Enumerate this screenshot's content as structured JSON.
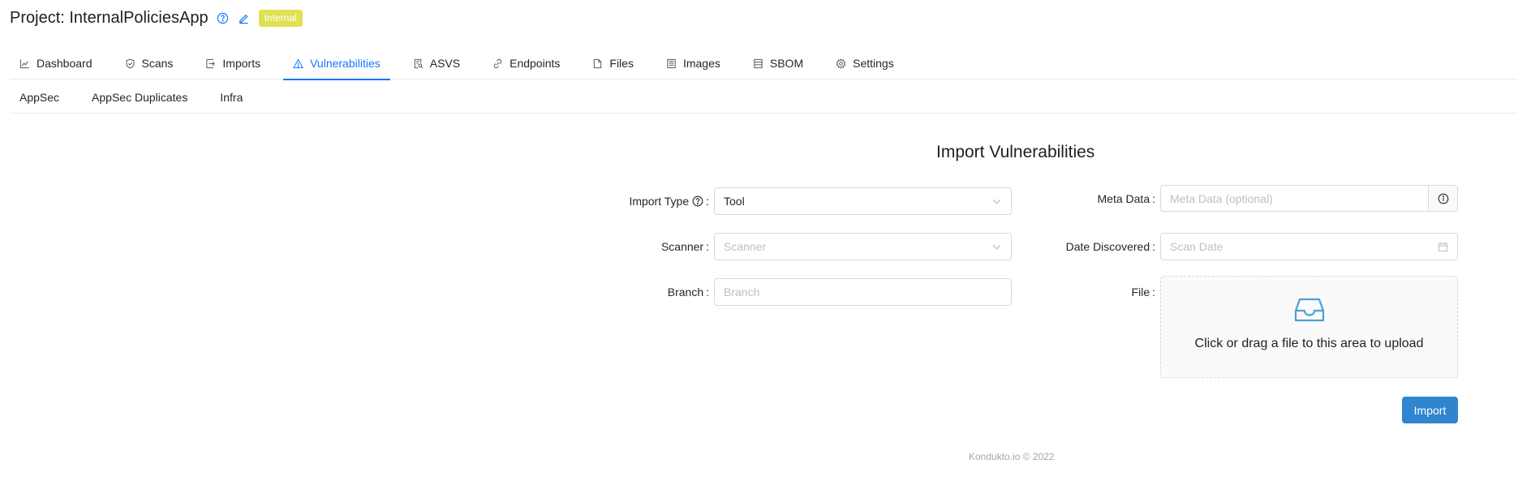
{
  "header": {
    "project_title": "Project: InternalPoliciesApp",
    "badge": "Internal",
    "icons": [
      "question-circle-icon",
      "edit-icon"
    ]
  },
  "tabs": [
    {
      "label": "Dashboard",
      "icon": "area-chart-icon",
      "active": false
    },
    {
      "label": "Scans",
      "icon": "safety-icon",
      "active": false
    },
    {
      "label": "Imports",
      "icon": "import-icon",
      "active": false
    },
    {
      "label": "Vulnerabilities",
      "icon": "warning-icon",
      "active": true
    },
    {
      "label": "ASVS",
      "icon": "file-search-icon",
      "active": false
    },
    {
      "label": "Endpoints",
      "icon": "link-icon",
      "active": false
    },
    {
      "label": "Files",
      "icon": "file-icon",
      "active": false
    },
    {
      "label": "Images",
      "icon": "container-icon",
      "active": false
    },
    {
      "label": "SBOM",
      "icon": "database-icon",
      "active": false
    },
    {
      "label": "Settings",
      "icon": "setting-icon",
      "active": false
    }
  ],
  "subtabs": [
    {
      "label": "AppSec"
    },
    {
      "label": "AppSec Duplicates"
    },
    {
      "label": "Infra"
    }
  ],
  "form": {
    "title": "Import Vulnerabilities",
    "import_type": {
      "label": "Import Type",
      "colon": ":",
      "value": "Tool"
    },
    "scanner": {
      "label": "Scanner",
      "colon": ":",
      "placeholder": "Scanner"
    },
    "branch": {
      "label": "Branch",
      "colon": ":",
      "placeholder": "Branch"
    },
    "meta_data": {
      "label": "Meta Data",
      "colon": ":",
      "placeholder": "Meta Data (optional)"
    },
    "date_discovered": {
      "label": "Date Discovered",
      "colon": ":",
      "placeholder": "Scan Date"
    },
    "file": {
      "label": "File",
      "colon": ":",
      "dropzone_text": "Click or drag a file to this area to upload"
    },
    "import_button": "Import"
  },
  "footer": {
    "text": "Kondukto.io © 2022"
  },
  "colors": {
    "accent": "#1677ff",
    "badge": "#dfe152",
    "button": "#2f86cf",
    "dropzone_icon": "#4d9fd8"
  }
}
